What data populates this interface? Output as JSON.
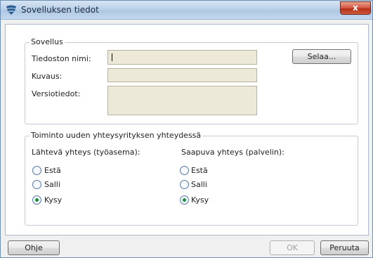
{
  "window": {
    "title": "Sovelluksen tiedot",
    "close_label": "x",
    "icon": "shield-icon"
  },
  "app_group": {
    "legend": "Sovellus",
    "filename_label": "Tiedoston nimi:",
    "filename_value": "",
    "description_label": "Kuvaus:",
    "description_value": "",
    "version_label": "Versiotiedot:",
    "version_value": "",
    "browse_label": "Selaa..."
  },
  "action_group": {
    "legend": "Toiminto uuden yhteysyrityksen yhteydessä",
    "outbound": {
      "heading": "Lähtevä yhteys (työasema):",
      "options": [
        {
          "label": "Estä",
          "checked": false
        },
        {
          "label": "Salli",
          "checked": false
        },
        {
          "label": "Kysy",
          "checked": true
        }
      ]
    },
    "inbound": {
      "heading": "Saapuva yhteys (palvelin):",
      "options": [
        {
          "label": "Estä",
          "checked": false
        },
        {
          "label": "Salli",
          "checked": false
        },
        {
          "label": "Kysy",
          "checked": true
        }
      ]
    }
  },
  "footer": {
    "help_label": "Ohje",
    "ok_label": "OK",
    "cancel_label": "Peruuta"
  }
}
